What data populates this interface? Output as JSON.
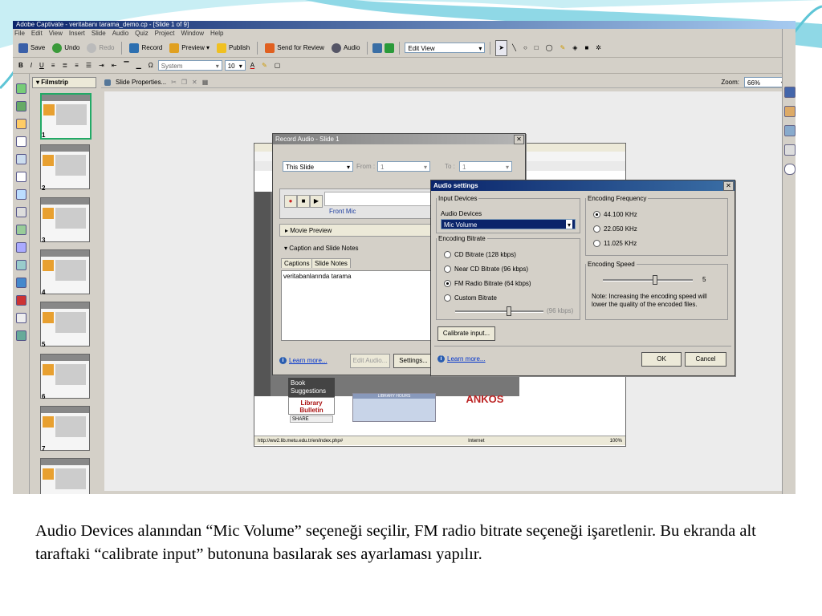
{
  "app": {
    "title": "Adobe Captivate - veritabanı tarama_demo.cp - [Slide 1 of 9]",
    "menu": [
      "File",
      "Edit",
      "View",
      "Insert",
      "Slide",
      "Audio",
      "Quiz",
      "Project",
      "Window",
      "Help"
    ],
    "toolbar": {
      "save": "Save",
      "undo": "Undo",
      "redo": "Redo",
      "record": "Record",
      "preview": "Preview ▾",
      "publish": "Publish",
      "send_for_review": "Send for Review",
      "audio": "Audio",
      "view_mode": "Edit View"
    },
    "format_bar": {
      "font": "System",
      "size": "10",
      "bold": "B",
      "italic": "I",
      "underline": "U",
      "font_color": "A"
    },
    "filmstrip": {
      "title": "Filmstrip",
      "close": "×",
      "slides": [
        "1",
        "2",
        "3",
        "4",
        "5",
        "6",
        "7"
      ]
    },
    "workspace": {
      "slide_properties": "Slide Properties...",
      "zoom_label": "Zoom:",
      "zoom_value": "66%"
    }
  },
  "record_audio": {
    "title": "Record Audio - Slide 1",
    "range_select": "This Slide",
    "from_label": "From :",
    "from_value": "1",
    "to_label": "To :",
    "to_value": "1",
    "device_label": "Front Mic",
    "movie_preview": "Movie Preview",
    "caption_notes": "Caption and Slide Notes",
    "tabs": [
      "Captions",
      "Slide Notes"
    ],
    "caption_text": "veritabanlarında tarama",
    "learn_more": "Learn more...",
    "edit_audio": "Edit Audio...",
    "settings": "Settings..."
  },
  "audio_settings": {
    "title": "Audio settings",
    "input_devices_legend": "Input Devices",
    "audio_devices_label": "Audio Devices",
    "audio_device_value": "Mic Volume",
    "bitrate_legend": "Encoding Bitrate",
    "bitrate_options": [
      "CD Bitrate (128 kbps)",
      "Near CD Bitrate (96 kbps)",
      "FM Radio Bitrate (64 kbps)",
      "Custom Bitrate"
    ],
    "bitrate_selected": 2,
    "custom_value": "(96 kbps)",
    "calibrate": "Calibrate input...",
    "frequency_legend": "Encoding Frequency",
    "frequency_options": [
      "44.100 KHz",
      "22.050 KHz",
      "11.025 KHz"
    ],
    "frequency_selected": 0,
    "speed_legend": "Encoding Speed",
    "speed_value": "5",
    "speed_note": "Note: Increasing the encoding speed will lower the quality of the encoded files.",
    "learn_more": "Learn more...",
    "ok": "OK",
    "cancel": "Cancel"
  },
  "browser": {
    "book_suggestions": "Book Suggestions",
    "library_bulletin": "Library Bulletin",
    "share": "SHARE",
    "library_hours": "LIBRARY HOURS",
    "ankos": "ANKOS",
    "status_url": "http://ww2.lib.metu.edu.tr/en/index.php#",
    "status_zone": "Internet",
    "status_zoom": "100%"
  },
  "caption": "Audio Devices alanından “Mic Volume” seçeneği seçilir, FM radio bitrate seçeneği işaretlenir.  Bu ekranda alt taraftaki “calibrate input” butonuna basılarak ses ayarlaması yapılır.",
  "colors": {
    "title_active": "#0a246a",
    "selection": "#0a246a",
    "teal_decoration": "#5ec5d6"
  }
}
